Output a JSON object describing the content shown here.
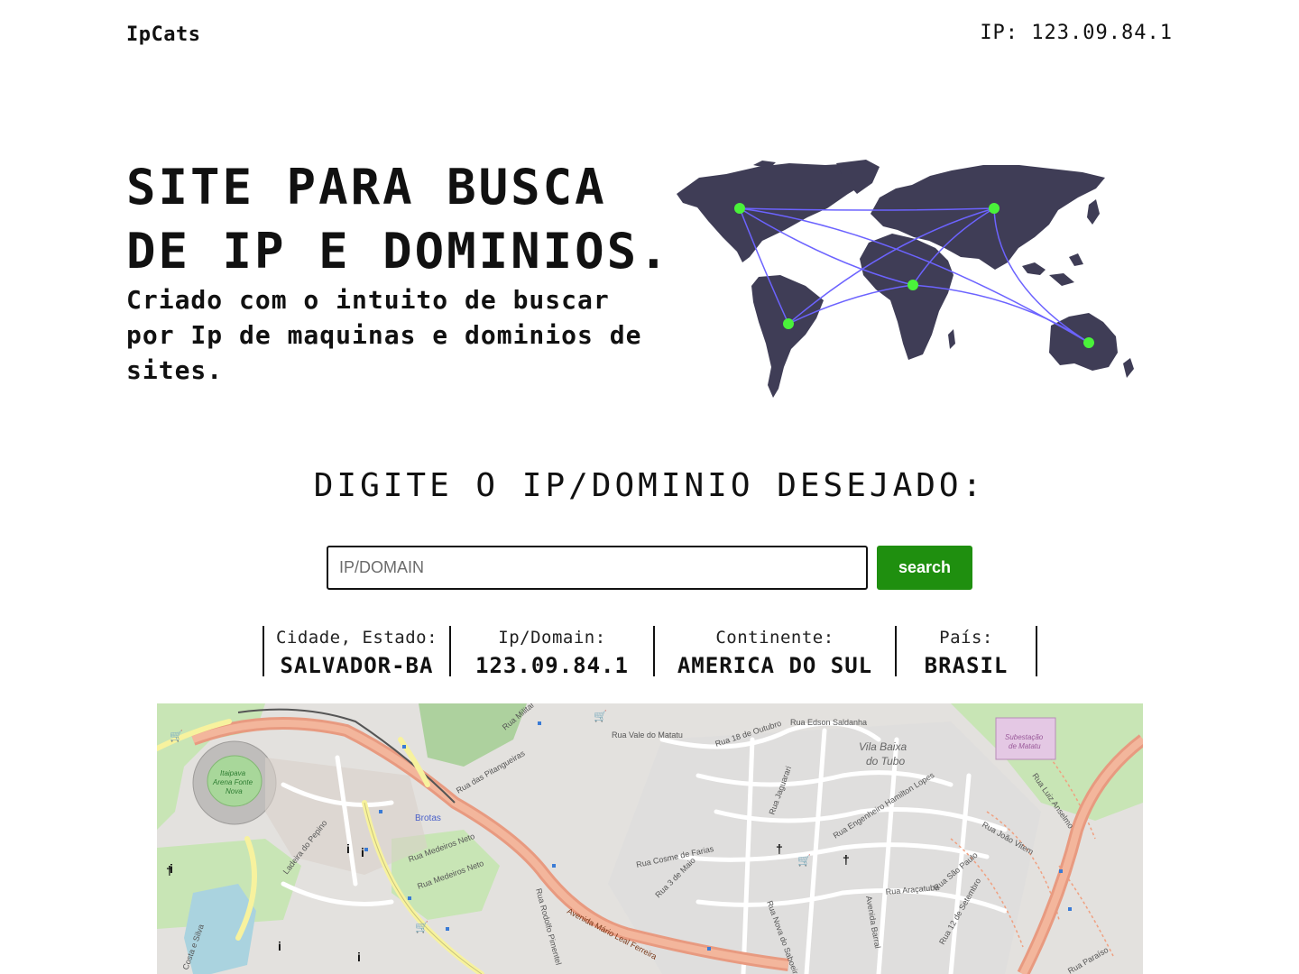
{
  "navbar": {
    "brand": "IpCats",
    "ip_text": "IP: 123.09.84.1"
  },
  "hero": {
    "title_line1": "SITE PARA BUSCA",
    "title_line2": "DE IP E DOMINIOS.",
    "subtitle": "Criado com o intuito de buscar por Ip de maquinas e dominios de sites."
  },
  "search": {
    "heading": "DIGITE O IP/DOMINIO DESEJADO:",
    "placeholder": "IP/DOMAIN",
    "button_label": "search"
  },
  "results": [
    {
      "label": "Cidade, Estado:",
      "value": "SALVADOR-BA"
    },
    {
      "label": "Ip/Domain:",
      "value": "123.09.84.1"
    },
    {
      "label": "Continente:",
      "value": "AMERICA DO SUL"
    },
    {
      "label": "País:",
      "value": "BRASIL"
    }
  ],
  "map": {
    "labels": {
      "rua_vale_do_matatu": "Rua Vale do Matatu",
      "rua_edson_saldanha": "Rua Edson Saldanha",
      "rua_18_de_outubro": "Rua 18 de Outubro",
      "vila_baixa": "Vila Baixa",
      "do_tubo": "do Tubo",
      "subestacao": "Subestação",
      "de_matatu": "de Matatu",
      "itaipava": "Itaipava",
      "arena_fonte": "Arena Fonte",
      "nova": "Nova",
      "brotas": "Brotas",
      "rua_medeiros_neto": "Rua Medeiros Neto",
      "ladeira_do_pepino": "Ladeira do Pepino",
      "rua_engenheiro": "Rua Engenheiro Hamilton Lopes",
      "rua_jaguarari": "Rua Jaguarari",
      "rua_cosme_de_farias": "Rua Cosme de Farias",
      "rua_3_de_maio": "Rua 3 de Maio",
      "rua_aracatuba": "Rua Araçatuba",
      "rua_sao_paulo": "Rua São Paulo",
      "rua_12_de_setembro": "Rua 12 de Setembro",
      "avenida_barral": "Avenida Barral",
      "av_mario_leal": "Avenida Mário Leal Ferreira",
      "rua_rodolfo": "Rua Rodolfo Pimentel",
      "rua_joao_vitem": "Rua João Vitem",
      "rua_luiz_anselmo": "Rua Luiz Anselmo",
      "rua_da_pitangueiras": "Rua das Pitangueiras",
      "rua_militar": "Rua Militar",
      "rua_nova_do_saboeiro": "Rua Nova do Saboeiro",
      "costa_e_silva": "Costa e Silva",
      "rua_paraiso": "Rua Paraíso"
    }
  },
  "colors": {
    "accent_green": "#1f8f0f",
    "map_dot": "#4af23a",
    "map_land": "#3f3d56",
    "map_line": "#6c63ff"
  },
  "icons": [
    "world-map-illustration",
    "map-tiles"
  ]
}
